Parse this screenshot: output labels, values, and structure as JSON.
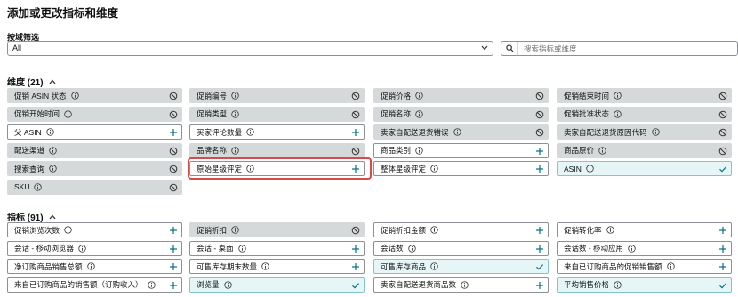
{
  "title": "添加或更改指标和维度",
  "filter": {
    "label": "按域筛选",
    "selected": "All"
  },
  "search": {
    "placeholder": "搜索指标或维度"
  },
  "dimensions": {
    "header": "维度 (21)",
    "items": [
      {
        "label": "促销 ASIN 状态",
        "state": "disabled"
      },
      {
        "label": "促销编号",
        "state": "disabled"
      },
      {
        "label": "促销价格",
        "state": "disabled"
      },
      {
        "label": "促销结束时间",
        "state": "disabled"
      },
      {
        "label": "促销开始时间",
        "state": "disabled"
      },
      {
        "label": "促销类型",
        "state": "disabled"
      },
      {
        "label": "促销名称",
        "state": "disabled"
      },
      {
        "label": "促销批准状态",
        "state": "disabled"
      },
      {
        "label": "父 ASIN",
        "state": "available"
      },
      {
        "label": "买家评论数量",
        "state": "available"
      },
      {
        "label": "卖家自配送退货错误",
        "state": "disabled"
      },
      {
        "label": "卖家自配送退货原因代码",
        "state": "disabled"
      },
      {
        "label": "配送渠道",
        "state": "disabled"
      },
      {
        "label": "品牌名称",
        "state": "disabled"
      },
      {
        "label": "商品类别",
        "state": "available"
      },
      {
        "label": "商品原价",
        "state": "disabled"
      },
      {
        "label": "搜索查询",
        "state": "disabled"
      },
      {
        "label": "原始星级评定",
        "state": "available"
      },
      {
        "label": "整体星级评定",
        "state": "available"
      },
      {
        "label": "ASIN",
        "state": "selected"
      },
      {
        "label": "SKU",
        "state": "disabled"
      }
    ]
  },
  "metrics": {
    "header": "指标 (91)",
    "items": [
      {
        "label": "促销浏览次数",
        "state": "available"
      },
      {
        "label": "促销折扣",
        "state": "disabled"
      },
      {
        "label": "促销折扣金额",
        "state": "available"
      },
      {
        "label": "促销转化率",
        "state": "available"
      },
      {
        "label": "会话 - 移动浏览器",
        "state": "available"
      },
      {
        "label": "会话 - 桌面",
        "state": "available"
      },
      {
        "label": "会话数",
        "state": "available"
      },
      {
        "label": "会话数 - 移动应用",
        "state": "available"
      },
      {
        "label": "净订购商品销售总额",
        "state": "available"
      },
      {
        "label": "可售库存期末数量",
        "state": "available"
      },
      {
        "label": "可售库存商品",
        "state": "selected"
      },
      {
        "label": "来自已订购商品的促销销售额",
        "state": "available"
      },
      {
        "label": "来自已订购商品的销售额（订购收入）",
        "state": "available"
      },
      {
        "label": "浏览量",
        "state": "selected"
      },
      {
        "label": "卖家自配送退货商品数",
        "state": "available"
      },
      {
        "label": "平均销售价格",
        "state": "selected"
      }
    ]
  },
  "colors": {
    "accent": "#007185",
    "disabled_bg": "#d5d9d9",
    "selected_bg": "#e6f6f7",
    "highlight": "#d94b4b"
  }
}
